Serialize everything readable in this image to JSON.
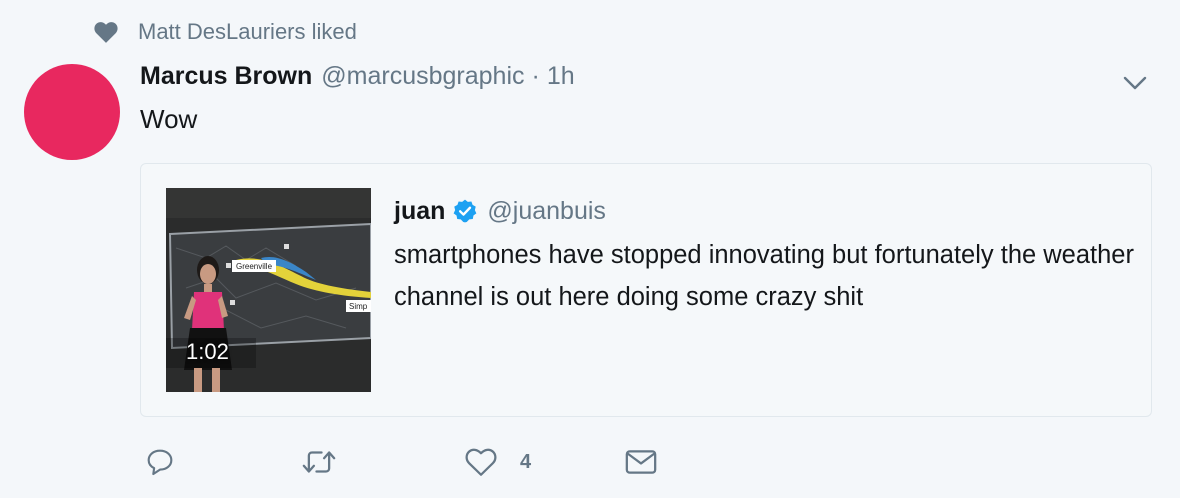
{
  "social_context": {
    "icon": "heart-icon",
    "text": "Matt DesLauriers liked"
  },
  "tweet": {
    "avatar_color": "#e8285f",
    "fullname": "Marcus Brown",
    "handle": "@marcusbgraphic",
    "separator": "·",
    "time": "1h",
    "text": "Wow",
    "quoted": {
      "fullname": "juan",
      "verified": true,
      "handle": "@juanbuis",
      "text": "smartphones have stopped innovating but fortunately the weather channel is out here doing some crazy shit",
      "media": {
        "duration": "1:02",
        "map_labels": [
          "Greenville",
          "Simp"
        ]
      }
    },
    "actions": {
      "reply_icon": "reply-icon",
      "retweet_icon": "retweet-icon",
      "like_icon": "heart-outline-icon",
      "like_count": "4",
      "dm_icon": "envelope-icon"
    }
  },
  "colors": {
    "background": "#f4f7fa",
    "secondary_text": "#657786",
    "verified_blue": "#1da1f2",
    "border": "#e1e8ed"
  }
}
